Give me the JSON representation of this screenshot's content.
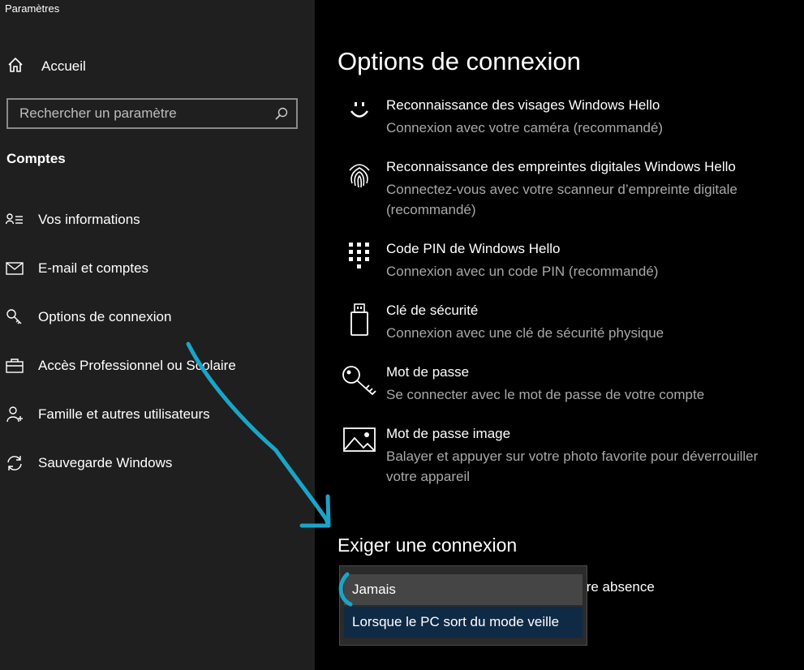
{
  "window": {
    "title": "Paramètres"
  },
  "sidebar": {
    "home_label": "Accueil",
    "search_placeholder": "Rechercher un paramètre",
    "section_title": "Comptes",
    "items": [
      {
        "label": "Vos informations",
        "icon": "user-info-icon"
      },
      {
        "label": "E-mail et comptes",
        "icon": "mail-icon"
      },
      {
        "label": "Options de connexion",
        "icon": "key-icon"
      },
      {
        "label": "Accès Professionnel ou Scolaire",
        "icon": "briefcase-icon"
      },
      {
        "label": "Famille et autres utilisateurs",
        "icon": "add-person-icon"
      },
      {
        "label": "Sauvegarde Windows",
        "icon": "sync-icon"
      }
    ]
  },
  "main": {
    "title": "Options de connexion",
    "options": [
      {
        "title": "Reconnaissance des visages Windows Hello",
        "desc": "Connexion avec votre caméra (recommandé)",
        "icon": "face-icon"
      },
      {
        "title": "Reconnaissance des empreintes digitales Windows Hello",
        "desc": "Connectez-vous avec votre scanneur d’empreinte digitale (recommandé)",
        "icon": "fingerprint-icon"
      },
      {
        "title": "Code PIN de Windows Hello",
        "desc": "Connexion avec un code PIN (recommandé)",
        "icon": "pin-keypad-icon"
      },
      {
        "title": "Clé de sécurité",
        "desc": "Connexion avec une clé de sécurité physique",
        "icon": "usb-key-icon"
      },
      {
        "title": "Mot de passe",
        "desc": "Se connecter avec le mot de passe de votre compte",
        "icon": "password-key-icon"
      },
      {
        "title": "Mot de passe image",
        "desc": "Balayer et appuyer sur votre photo favorite pour déverrouiller votre appareil",
        "icon": "picture-icon"
      }
    ],
    "require_title": "Exiger une connexion",
    "require_partial_text": "tre absence",
    "dropdown_options": [
      "Jamais",
      "Lorsque le PC sort du mode veille"
    ]
  },
  "colors": {
    "sidebar_bg": "#1f1f1f",
    "main_bg": "#000000",
    "annotation": "#1aa5c8",
    "selected_option": "#0f2a45"
  }
}
